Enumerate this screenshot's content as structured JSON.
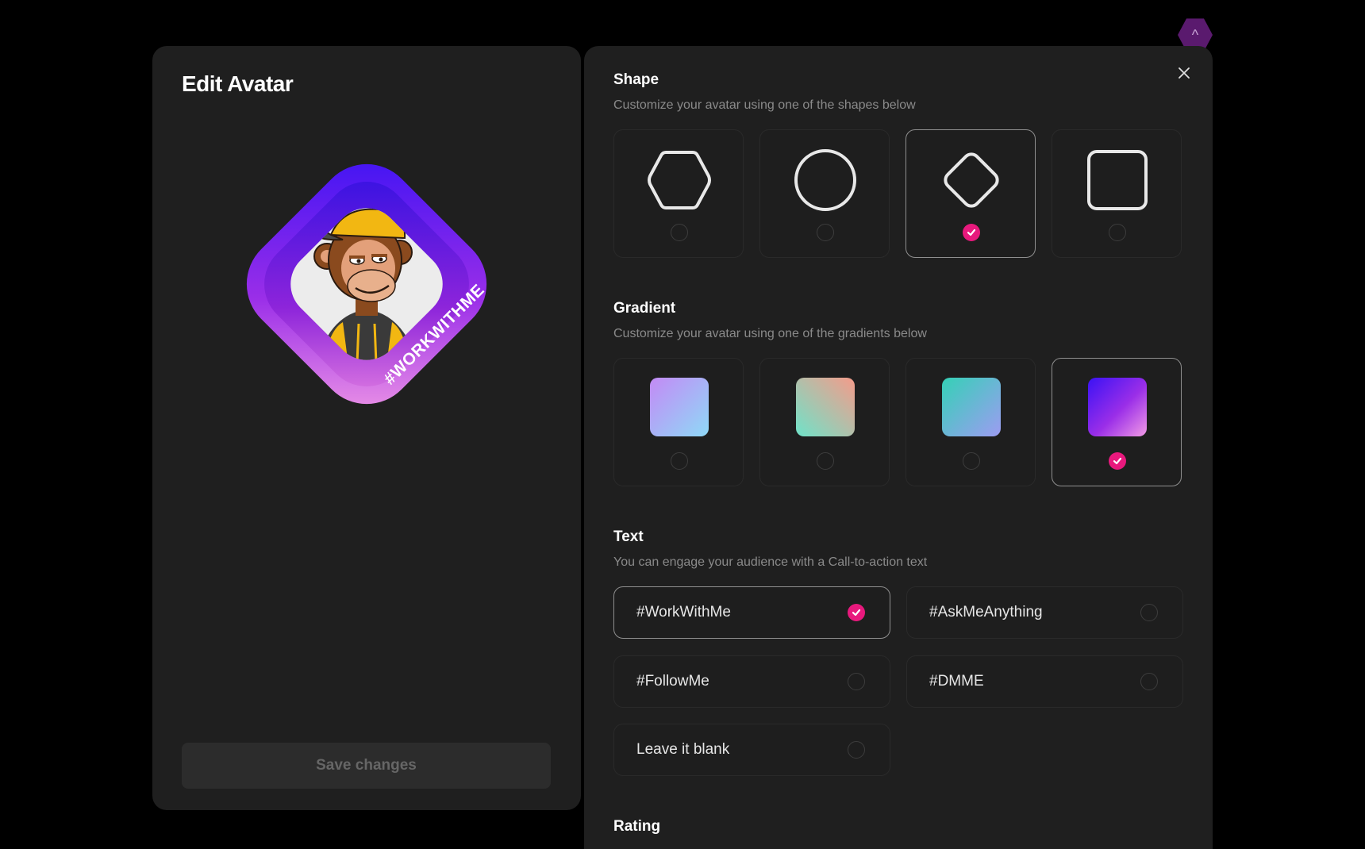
{
  "left": {
    "title": "Edit Avatar",
    "preview_text": "#WORKWITHME",
    "save_label": "Save changes"
  },
  "shape": {
    "title": "Shape",
    "description": "Customize your avatar using one of the shapes below",
    "options": [
      {
        "name": "hexagon",
        "selected": false
      },
      {
        "name": "circle",
        "selected": false
      },
      {
        "name": "diamond",
        "selected": true
      },
      {
        "name": "square",
        "selected": false
      }
    ]
  },
  "gradient": {
    "title": "Gradient",
    "description": "Customize your avatar using one of the gradients below",
    "options": [
      {
        "name": "lavender-sky",
        "from": "#c38af5",
        "to": "#8fd9f7",
        "selected": false
      },
      {
        "name": "peach-mint",
        "from": "#f59b8a",
        "to": "#6fe3c9",
        "selected": false
      },
      {
        "name": "teal-periwinkle",
        "from": "#34d1b6",
        "to": "#9d9cf2",
        "selected": false
      },
      {
        "name": "indigo-violet",
        "from": "#3a12f5",
        "to": "#f29be6",
        "selected": true
      }
    ]
  },
  "text": {
    "title": "Text",
    "description": "You can engage your audience with a Call-to-action text",
    "options": [
      {
        "label": "#WorkWithMe",
        "selected": true
      },
      {
        "label": "#AskMeAnything",
        "selected": false
      },
      {
        "label": "#FollowMe",
        "selected": false
      },
      {
        "label": "#DMME",
        "selected": false
      },
      {
        "label": "Leave it blank",
        "selected": false
      }
    ]
  },
  "rating": {
    "title": "Rating"
  },
  "colors": {
    "accent": "#e8197d",
    "panel": "#1f1f1f",
    "background": "#000000"
  }
}
